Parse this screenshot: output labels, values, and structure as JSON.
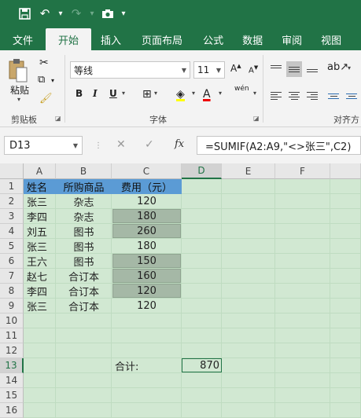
{
  "quick_access": {
    "save_icon": "save-icon",
    "undo_icon": "undo-icon",
    "redo_icon": "redo-icon",
    "camera_icon": "camera-icon",
    "customize_icon": "customize-dropdown-icon"
  },
  "ribbon_tabs": [
    "文件",
    "开始",
    "插入",
    "页面布局",
    "公式",
    "数据",
    "审阅",
    "视图"
  ],
  "active_tab": "开始",
  "clipboard": {
    "paste_label": "粘贴",
    "group_label": "剪贴板"
  },
  "font": {
    "name": "等线",
    "size": "11",
    "group_label": "字体",
    "bold": "B",
    "italic": "I",
    "underline": "U",
    "grow": "A",
    "shrink": "A",
    "font_color_glyph": "A",
    "phonetic": "wén"
  },
  "alignment": {
    "group_label": "对齐方"
  },
  "formula_bar": {
    "name_box": "D13",
    "formula": "=SUMIF(A2:A9,\"<>张三\",C2)",
    "fx_label": "fx"
  },
  "columns": [
    "A",
    "B",
    "C",
    "D",
    "E",
    "F"
  ],
  "rows": [
    "1",
    "2",
    "3",
    "4",
    "5",
    "6",
    "7",
    "8",
    "9",
    "10",
    "11",
    "12",
    "13",
    "14",
    "15",
    "16"
  ],
  "table": {
    "headers": [
      "姓名",
      "所购商品",
      "费用（元）"
    ],
    "rows": [
      [
        "张三",
        "杂志",
        "120"
      ],
      [
        "李四",
        "杂志",
        "180"
      ],
      [
        "刘五",
        "图书",
        "260"
      ],
      [
        "张三",
        "图书",
        "180"
      ],
      [
        "王六",
        "图书",
        "150"
      ],
      [
        "赵七",
        "合订本",
        "160"
      ],
      [
        "李四",
        "合订本",
        "120"
      ],
      [
        "张三",
        "合订本",
        "120"
      ]
    ]
  },
  "total": {
    "label": "合计:",
    "value": "870"
  },
  "colors": {
    "accent": "#217346",
    "header_fill": "#5b9bd5",
    "sheet_bg": "#d1e8d2",
    "highlight_fill": "#a5b8a6"
  }
}
